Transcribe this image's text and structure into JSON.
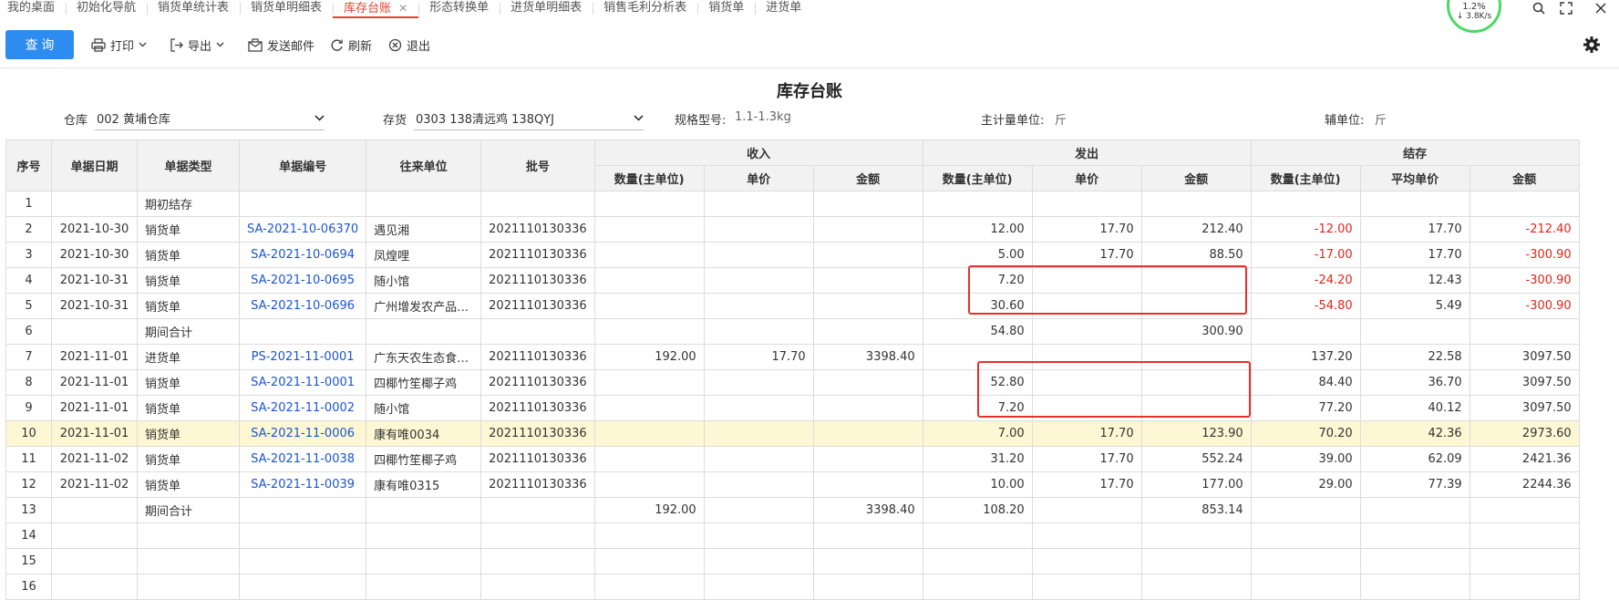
{
  "tabs": [
    {
      "label": "我的桌面",
      "active": false
    },
    {
      "label": "初始化导航",
      "active": false
    },
    {
      "label": "销货单统计表",
      "active": false
    },
    {
      "label": "销货单明细表",
      "active": false
    },
    {
      "label": "库存台账",
      "active": true
    },
    {
      "label": "形态转换单",
      "active": false
    },
    {
      "label": "进货单明细表",
      "active": false
    },
    {
      "label": "销售毛利分析表",
      "active": false
    },
    {
      "label": "销货单",
      "active": false
    },
    {
      "label": "进货单",
      "active": false
    }
  ],
  "speed": {
    "top": "1.2%",
    "net": "↓ 3.8K/s"
  },
  "toolbar": {
    "query": "查 询",
    "print": "打印",
    "export": "导出",
    "mail": "发送邮件",
    "refresh": "刷新",
    "exit": "退出"
  },
  "report": {
    "title": "库存台账",
    "warehouse_label": "仓库",
    "warehouse_value": "002 黄埔仓库",
    "stock_label": "存货",
    "stock_value": "0303 138清远鸡 138QYJ",
    "spec_label": "规格型号:",
    "spec_value": "1.1-1.3kg",
    "main_unit_label": "主计量单位:",
    "main_unit_value": "斤",
    "aux_unit_label": "辅单位:",
    "aux_unit_value": "斤"
  },
  "table": {
    "headers": {
      "seq": "序号",
      "date": "单据日期",
      "type": "单据类型",
      "no": "单据编号",
      "partner": "往来单位",
      "batch": "批号",
      "in_group": "收入",
      "out_group": "发出",
      "bal_group": "结存",
      "qty": "数量(主单位)",
      "price": "单价",
      "amount": "金额",
      "avg_price": "平均单价"
    },
    "rows": [
      {
        "seq": "1",
        "date": "",
        "type": "期初结存",
        "no": "",
        "partner": "",
        "batch": "",
        "in_qty": "",
        "in_price": "",
        "in_amt": "",
        "out_qty": "",
        "out_price": "",
        "out_amt": "",
        "bal_qty": "",
        "bal_price": "",
        "bal_amt": "",
        "neg": false,
        "link": false
      },
      {
        "seq": "2",
        "date": "2021-10-30",
        "type": "销货单",
        "no": "SA-2021-10-06370",
        "partner": "遇见湘",
        "batch": "2021110130336",
        "in_qty": "",
        "in_price": "",
        "in_amt": "",
        "out_qty": "12.00",
        "out_price": "17.70",
        "out_amt": "212.40",
        "bal_qty": "-12.00",
        "bal_price": "17.70",
        "bal_amt": "-212.40",
        "neg": true,
        "link": true
      },
      {
        "seq": "3",
        "date": "2021-10-30",
        "type": "销货单",
        "no": "SA-2021-10-0694",
        "partner": "凤煌哩",
        "batch": "2021110130336",
        "in_qty": "",
        "in_price": "",
        "in_amt": "",
        "out_qty": "5.00",
        "out_price": "17.70",
        "out_amt": "88.50",
        "bal_qty": "-17.00",
        "bal_price": "17.70",
        "bal_amt": "-300.90",
        "neg": true,
        "link": true
      },
      {
        "seq": "4",
        "date": "2021-10-31",
        "type": "销货单",
        "no": "SA-2021-10-0695",
        "partner": "随小馆",
        "batch": "2021110130336",
        "in_qty": "",
        "in_price": "",
        "in_amt": "",
        "out_qty": "7.20",
        "out_price": "",
        "out_amt": "",
        "bal_qty": "-24.20",
        "bal_price": "12.43",
        "bal_amt": "-300.90",
        "neg": true,
        "link": true
      },
      {
        "seq": "5",
        "date": "2021-10-31",
        "type": "销货单",
        "no": "SA-2021-10-0696",
        "partner": "广州增发农产品…",
        "batch": "2021110130336",
        "in_qty": "",
        "in_price": "",
        "in_amt": "",
        "out_qty": "30.60",
        "out_price": "",
        "out_amt": "",
        "bal_qty": "-54.80",
        "bal_price": "5.49",
        "bal_amt": "-300.90",
        "neg": true,
        "link": true
      },
      {
        "seq": "6",
        "date": "",
        "type": "期间合计",
        "no": "",
        "partner": "",
        "batch": "",
        "in_qty": "",
        "in_price": "",
        "in_amt": "",
        "out_qty": "54.80",
        "out_price": "",
        "out_amt": "300.90",
        "bal_qty": "",
        "bal_price": "",
        "bal_amt": "",
        "neg": false,
        "link": false
      },
      {
        "seq": "7",
        "date": "2021-11-01",
        "type": "进货单",
        "no": "PS-2021-11-0001",
        "partner": "广东天农生态食…",
        "batch": "2021110130336",
        "in_qty": "192.00",
        "in_price": "17.70",
        "in_amt": "3398.40",
        "out_qty": "",
        "out_price": "",
        "out_amt": "",
        "bal_qty": "137.20",
        "bal_price": "22.58",
        "bal_amt": "3097.50",
        "neg": false,
        "link": true
      },
      {
        "seq": "8",
        "date": "2021-11-01",
        "type": "销货单",
        "no": "SA-2021-11-0001",
        "partner": "四椰竹笙椰子鸡",
        "batch": "2021110130336",
        "in_qty": "",
        "in_price": "",
        "in_amt": "",
        "out_qty": "52.80",
        "out_price": "",
        "out_amt": "",
        "bal_qty": "84.40",
        "bal_price": "36.70",
        "bal_amt": "3097.50",
        "neg": false,
        "link": true
      },
      {
        "seq": "9",
        "date": "2021-11-01",
        "type": "销货单",
        "no": "SA-2021-11-0002",
        "partner": "随小馆",
        "batch": "2021110130336",
        "in_qty": "",
        "in_price": "",
        "in_amt": "",
        "out_qty": "7.20",
        "out_price": "",
        "out_amt": "",
        "bal_qty": "77.20",
        "bal_price": "40.12",
        "bal_amt": "3097.50",
        "neg": false,
        "link": true
      },
      {
        "seq": "10",
        "date": "2021-11-01",
        "type": "销货单",
        "no": "SA-2021-11-0006",
        "partner": "康有唯0034",
        "batch": "2021110130336",
        "in_qty": "",
        "in_price": "",
        "in_amt": "",
        "out_qty": "7.00",
        "out_price": "17.70",
        "out_amt": "123.90",
        "bal_qty": "70.20",
        "bal_price": "42.36",
        "bal_amt": "2973.60",
        "neg": false,
        "link": true,
        "highlight": true
      },
      {
        "seq": "11",
        "date": "2021-11-02",
        "type": "销货单",
        "no": "SA-2021-11-0038",
        "partner": "四椰竹笙椰子鸡",
        "batch": "2021110130336",
        "in_qty": "",
        "in_price": "",
        "in_amt": "",
        "out_qty": "31.20",
        "out_price": "17.70",
        "out_amt": "552.24",
        "bal_qty": "39.00",
        "bal_price": "62.09",
        "bal_amt": "2421.36",
        "neg": false,
        "link": true
      },
      {
        "seq": "12",
        "date": "2021-11-02",
        "type": "销货单",
        "no": "SA-2021-11-0039",
        "partner": "康有唯0315",
        "batch": "2021110130336",
        "in_qty": "",
        "in_price": "",
        "in_amt": "",
        "out_qty": "10.00",
        "out_price": "17.70",
        "out_amt": "177.00",
        "bal_qty": "29.00",
        "bal_price": "77.39",
        "bal_amt": "2244.36",
        "neg": false,
        "link": true
      },
      {
        "seq": "13",
        "date": "",
        "type": "期间合计",
        "no": "",
        "partner": "",
        "batch": "",
        "in_qty": "192.00",
        "in_price": "",
        "in_amt": "3398.40",
        "out_qty": "108.20",
        "out_price": "",
        "out_amt": "853.14",
        "bal_qty": "",
        "bal_price": "",
        "bal_amt": "",
        "neg": false,
        "link": false
      },
      {
        "seq": "14",
        "date": "",
        "type": "",
        "no": "",
        "partner": "",
        "batch": "",
        "in_qty": "",
        "in_price": "",
        "in_amt": "",
        "out_qty": "",
        "out_price": "",
        "out_amt": "",
        "bal_qty": "",
        "bal_price": "",
        "bal_amt": "",
        "neg": false,
        "link": false
      },
      {
        "seq": "15",
        "date": "",
        "type": "",
        "no": "",
        "partner": "",
        "batch": "",
        "in_qty": "",
        "in_price": "",
        "in_amt": "",
        "out_qty": "",
        "out_price": "",
        "out_amt": "",
        "bal_qty": "",
        "bal_price": "",
        "bal_amt": "",
        "neg": false,
        "link": false
      },
      {
        "seq": "16",
        "date": "",
        "type": "",
        "no": "",
        "partner": "",
        "batch": "",
        "in_qty": "",
        "in_price": "",
        "in_amt": "",
        "out_qty": "",
        "out_price": "",
        "out_amt": "",
        "bal_qty": "",
        "bal_price": "",
        "bal_amt": "",
        "neg": false,
        "link": false
      }
    ]
  },
  "colors": {
    "accent": "#2d8cf0",
    "active_tab": "#e8402b",
    "negative": "#e0261b",
    "link": "#1a55d6",
    "highlight_row": "#fdf7d4",
    "annotation": "#e8302a"
  },
  "icons": [
    "printer-icon",
    "export-icon",
    "mail-icon",
    "refresh-icon",
    "exit-icon",
    "settings-gear-icon",
    "search-icon",
    "fullscreen-icon",
    "close-icon"
  ]
}
